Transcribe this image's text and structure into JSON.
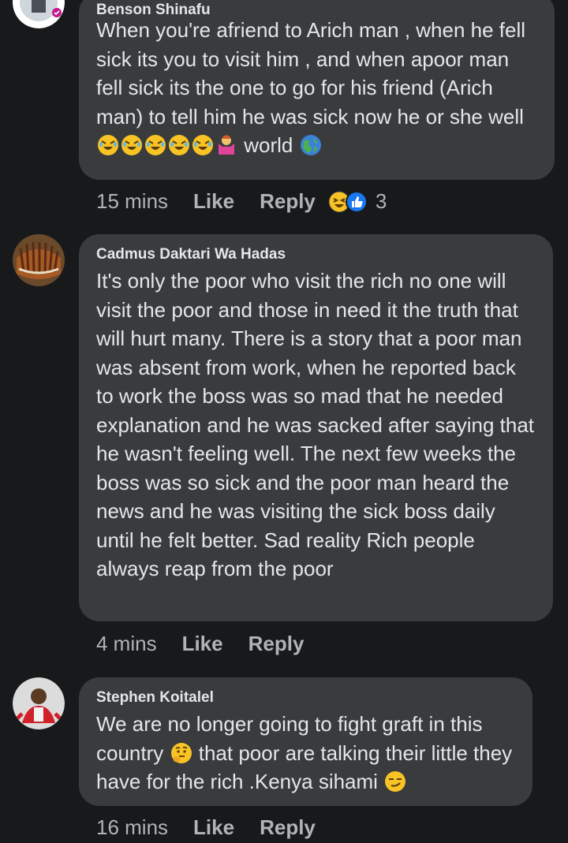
{
  "comments": [
    {
      "author": "Benson Shinafu",
      "text_before_emoji": "When you're afriend to Arich man , when he fell sick its you to visit him , and when apoor man fell sick its the one to go for his friend (Arich man) to tell him he was sick now he or she well",
      "text_after_emoji": "world",
      "time": "15 mins",
      "like_label": "Like",
      "reply_label": "Reply",
      "reaction_count": "3"
    },
    {
      "author": "Cadmus Daktari Wa Hadas",
      "text": "It's only the poor who visit the rich no one will visit the poor and those in need it the truth that will hurt many. There is a story that a poor man was absent from work, when he reported back to work the boss was so mad that he needed explanation and he was sacked after saying that he wasn't feeling well. The next few weeks the boss was so sick and the poor man heard the news and he was visiting the sick boss daily until he felt better. Sad reality Rich people always reap from the poor",
      "time": "4 mins",
      "like_label": "Like",
      "reply_label": "Reply"
    },
    {
      "author": "Stephen Koitalel",
      "text_part1": "We are no longer going to fight graft in this country",
      "text_part2": "that poor are talking their little they have for the rich .Kenya sihami",
      "time": "16 mins",
      "like_label": "Like",
      "reply_label": "Reply"
    }
  ]
}
